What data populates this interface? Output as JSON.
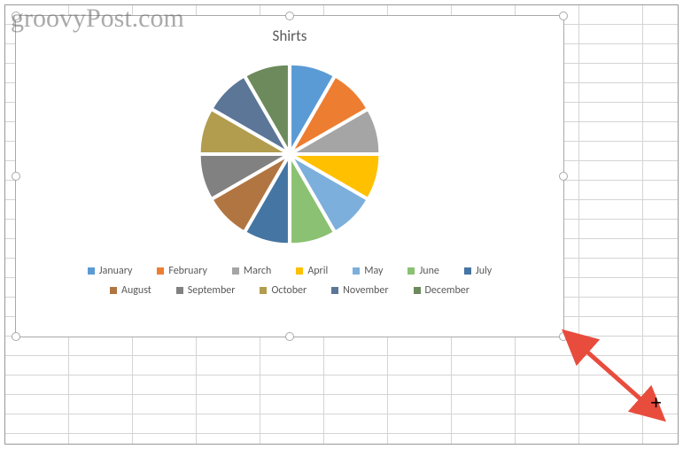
{
  "watermark": "groovyPost.com",
  "chart_data": {
    "type": "pie",
    "title": "Shirts",
    "categories": [
      "January",
      "February",
      "March",
      "April",
      "May",
      "June",
      "July",
      "August",
      "September",
      "October",
      "November",
      "December"
    ],
    "values": [
      8.3,
      8.3,
      8.3,
      8.3,
      8.3,
      8.3,
      8.3,
      8.3,
      8.3,
      8.3,
      8.3,
      8.3
    ],
    "colors": [
      "#5B9BD5",
      "#ED7D31",
      "#A5A5A5",
      "#FFC000",
      "#4472C4",
      "#70AD47",
      "#255E91",
      "#9E480E",
      "#636363",
      "#997300",
      "#264478",
      "#43682B"
    ],
    "series_colors_exploded": [
      "#5B9BD5",
      "#ED7D31",
      "#A5A5A5",
      "#FFC000",
      "#7CAFDC",
      "#8BC172",
      "#4575A2",
      "#B17541",
      "#818181",
      "#B29C4E",
      "#5B7697",
      "#6C8A5B"
    ]
  }
}
